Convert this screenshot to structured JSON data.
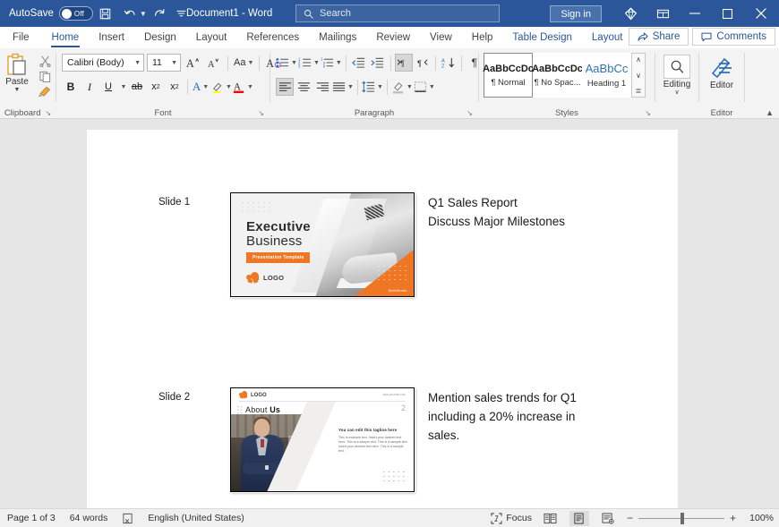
{
  "titlebar": {
    "autosave_label": "AutoSave",
    "autosave_state": "Off",
    "save_icon": "save-icon",
    "undo_icon": "undo-icon",
    "redo_icon": "redo-icon",
    "qat_more_icon": "customize-quick-access-toolbar-icon",
    "document_title": "Document1  -  Word",
    "search_placeholder": "Search",
    "search_icon": "search-icon",
    "signin_label": "Sign in",
    "diamond_icon": "office-diamond-icon",
    "ribbon_display_icon": "ribbon-display-options-icon",
    "minimize_icon": "minimize-icon",
    "maximize_icon": "maximize-icon",
    "close_icon": "close-icon"
  },
  "ribbon_tabs": {
    "items": [
      {
        "label": "File",
        "active": false
      },
      {
        "label": "Home",
        "active": true
      },
      {
        "label": "Insert",
        "active": false
      },
      {
        "label": "Design",
        "active": false
      },
      {
        "label": "Layout",
        "active": false
      },
      {
        "label": "References",
        "active": false
      },
      {
        "label": "Mailings",
        "active": false
      },
      {
        "label": "Review",
        "active": false
      },
      {
        "label": "View",
        "active": false
      },
      {
        "label": "Help",
        "active": false
      }
    ],
    "contextual": [
      {
        "label": "Table Design"
      },
      {
        "label": "Layout"
      }
    ],
    "share_label": "Share",
    "comments_label": "Comments",
    "accent_color": "#2b579a"
  },
  "ribbon": {
    "clipboard": {
      "group_label": "Clipboard",
      "paste_label": "Paste",
      "cut_label": "Cut",
      "copy_label": "Copy",
      "format_painter_label": "Format Painter",
      "dialog_launcher": "↘"
    },
    "font": {
      "group_label": "Font",
      "font_family_value": "Calibri (Body)",
      "font_size_value": "11",
      "grow_font_label": "A",
      "shrink_font_label": "A",
      "change_case_label": "Aa",
      "clear_formatting_label": "A",
      "bold_label": "B",
      "italic_label": "I",
      "underline_label": "U",
      "strikethrough_label": "ab",
      "subscript_label": "x",
      "superscript_label": "x",
      "text_effects_label": "A",
      "highlight_label": "✎",
      "font_color_label": "A",
      "highlight_color": "#ffff00",
      "font_color": "#ff0000",
      "dialog_launcher": "↘"
    },
    "paragraph": {
      "group_label": "Paragraph",
      "bullets_label": "Bullets",
      "numbering_label": "Numbering",
      "multilevel_label": "Multilevel List",
      "decrease_indent_label": "Decrease Indent",
      "increase_indent_label": "Increase Indent",
      "ltr_label": "Left-to-Right",
      "rtl_label": "Right-to-Left",
      "sort_label": "Sort",
      "show_marks_label": "¶",
      "align_left_label": "Align Left",
      "align_center_label": "Center",
      "align_right_label": "Align Right",
      "justify_label": "Justify",
      "line_spacing_label": "Line and Paragraph Spacing",
      "shading_label": "Shading",
      "borders_label": "Borders",
      "dialog_launcher": "↘"
    },
    "styles": {
      "group_label": "Styles",
      "dialog_launcher": "↘",
      "items": [
        {
          "preview": "AaBbCcDc",
          "name": "¶ Normal",
          "selected": true
        },
        {
          "preview": "AaBbCcDc",
          "name": "¶ No Spac...",
          "selected": false
        },
        {
          "preview": "AaBbCс",
          "name": "Heading 1",
          "selected": false
        }
      ],
      "scroll_up": "∧",
      "scroll_down": "∨",
      "scroll_more": "≣"
    },
    "editing": {
      "group_label": "",
      "button_label": "Editing",
      "caret": "∨"
    },
    "editor": {
      "group_label": "Editor",
      "button_label": "Editor"
    },
    "collapse_icon": "collapse-ribbon-icon"
  },
  "document": {
    "rows": [
      {
        "slide_label": "Slide 1",
        "thumbnail": {
          "name": "slide-1-thumbnail",
          "title_line1": "Executive",
          "title_line2": "Business",
          "badge": "Presentation Template",
          "logo_text": "LOGO",
          "brand_text": "SlideModel..."
        },
        "text_lines": [
          "Q1 Sales Report",
          "Discuss Major Milestones"
        ]
      },
      {
        "slide_label": "Slide 2",
        "thumbnail": {
          "name": "slide-2-thumbnail",
          "logo_text": "LOGO",
          "url_text": "www.yoursite.com",
          "heading_normal": "About ",
          "heading_bold": "Us",
          "page_number": "2",
          "tagline": "You can edit this tagline here",
          "body": "This is example text. Insert your desired text here. This is a sample text. This is a sample text. Insert your desired text here. This is a sample text."
        },
        "text_lines": [
          "Mention sales trends for Q1",
          "including a 20% increase in",
          "sales."
        ]
      }
    ]
  },
  "statusbar": {
    "page_indicator": "Page 1 of 3",
    "word_count": "64 words",
    "proofing_icon": "proofing-errors-icon",
    "language": "English (United States)",
    "focus_label": "Focus",
    "focus_icon": "focus-mode-icon",
    "view_read_icon": "read-mode-icon",
    "view_print_icon": "print-layout-icon",
    "view_web_icon": "web-layout-icon",
    "zoom_out": "−",
    "zoom_in": "+",
    "zoom_level": "100%"
  }
}
